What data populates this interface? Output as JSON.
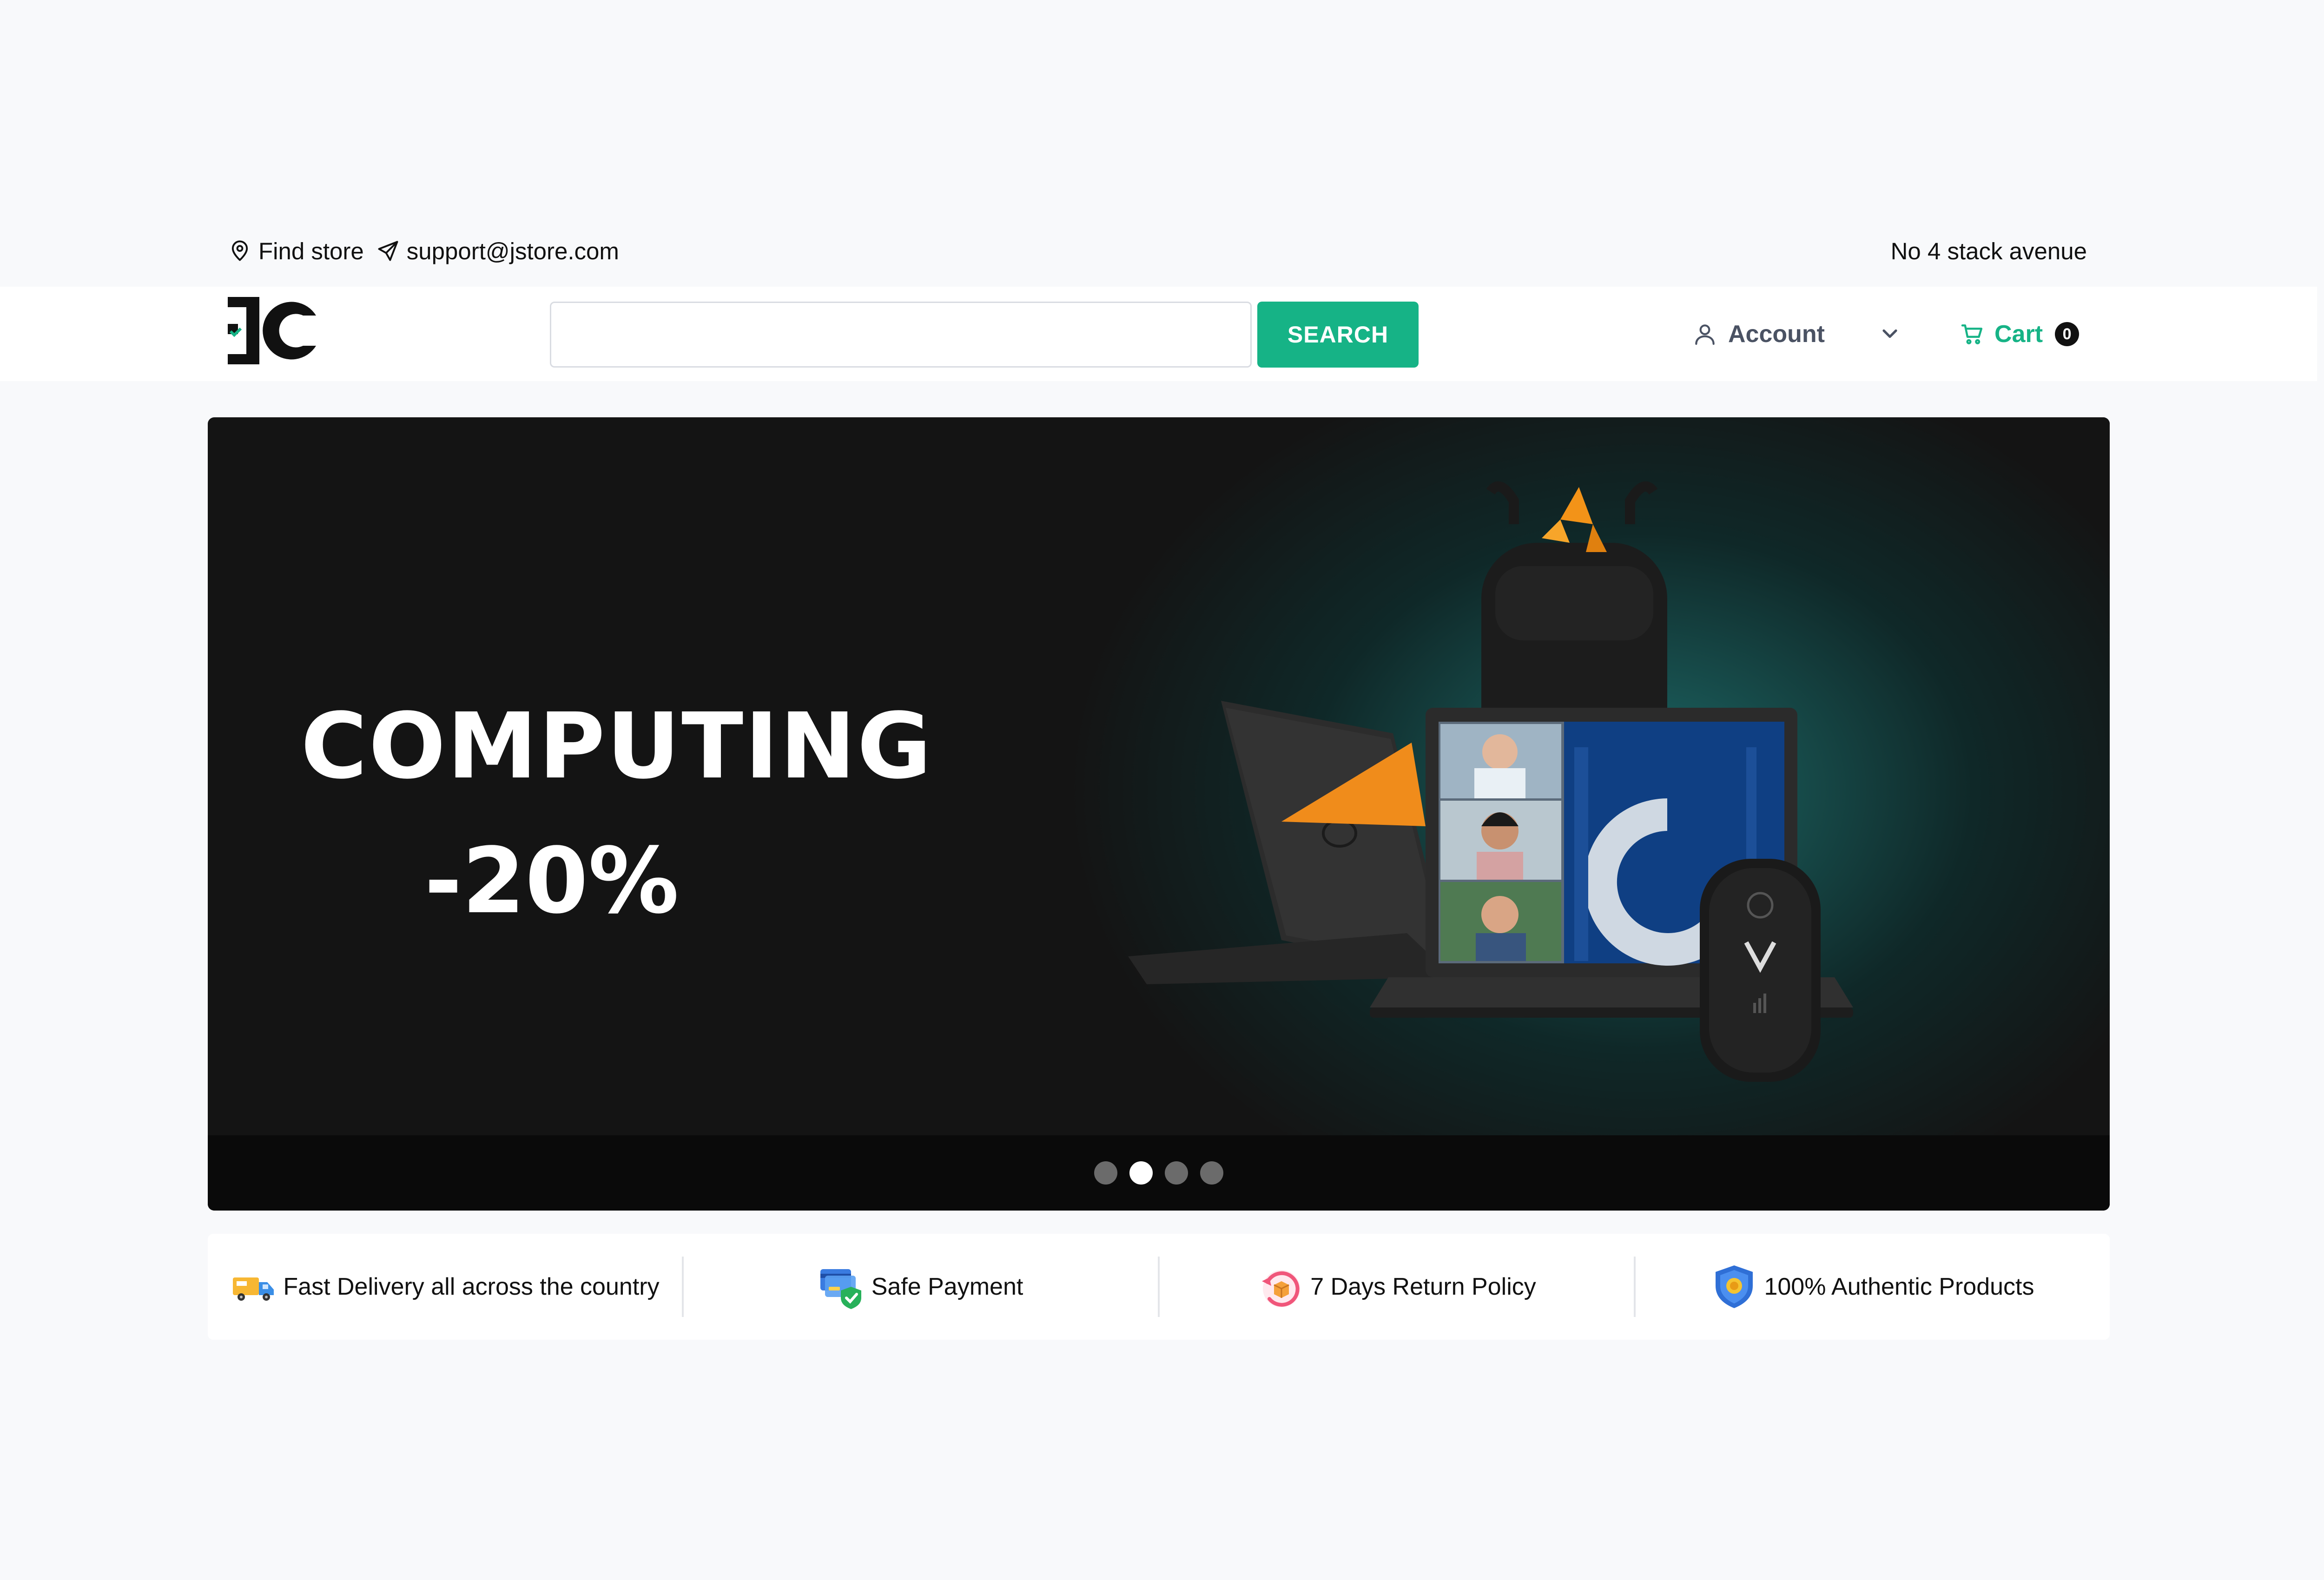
{
  "topbar": {
    "find_store": "Find store",
    "email": "support@jstore.com",
    "address": "No 4 stack avenue"
  },
  "header": {
    "search_placeholder": "",
    "search_button": "SEARCH",
    "account_label": "Account",
    "cart_label": "Cart",
    "cart_count": "0"
  },
  "hero": {
    "heading": "COMPUTING",
    "discount": "-20%",
    "slides": 4,
    "active_slide": 2
  },
  "features": [
    {
      "label": "Fast Delivery all across the country",
      "icon": "delivery-truck-icon"
    },
    {
      "label": "Safe Payment",
      "icon": "safe-payment-icon"
    },
    {
      "label": "7 Days Return Policy",
      "icon": "return-policy-icon"
    },
    {
      "label": "100% Authentic Products",
      "icon": "authentic-shield-icon"
    }
  ],
  "colors": {
    "accent": "#16b386",
    "page_bg": "#f8f9fb",
    "hero_bg": "#141414",
    "hero_glow": "#1d6a68"
  }
}
